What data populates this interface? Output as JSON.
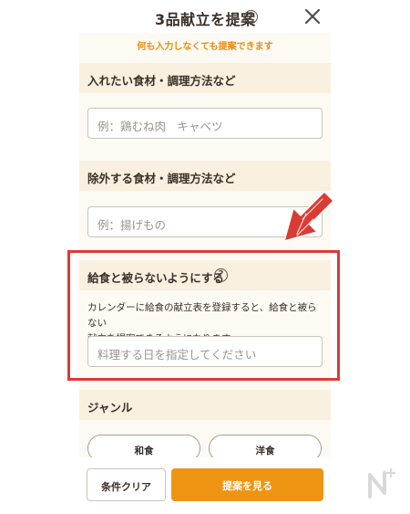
{
  "header": {
    "title": "3品献立を提案",
    "help_glyph": "?",
    "close_icon": "close-icon"
  },
  "notice": "何も入力しなくても提案できます",
  "sections": {
    "include": {
      "label": "入れたい食材・調理方法など",
      "placeholder": "例：鶏むね肉　キャベツ"
    },
    "exclude": {
      "label": "除外する食材・調理方法など",
      "placeholder": "例：揚げもの"
    },
    "school_lunch": {
      "label": "給食と被らないようにする",
      "help_glyph": "?",
      "description_line1": "カレンダーに給食の献立表を登録すると、給食と被らない",
      "description_line2": "献立を提案できるようになります。",
      "placeholder": "料理する日を指定してください"
    },
    "genre": {
      "label": "ジャンル",
      "options": [
        "和食",
        "洋食"
      ]
    }
  },
  "footer": {
    "clear_label": "条件クリア",
    "submit_label": "提案を見る"
  },
  "colors": {
    "accent": "#ef9412",
    "notice": "#ec8a0d",
    "highlight": "#d83c34",
    "section_bg": "#faf0df"
  }
}
